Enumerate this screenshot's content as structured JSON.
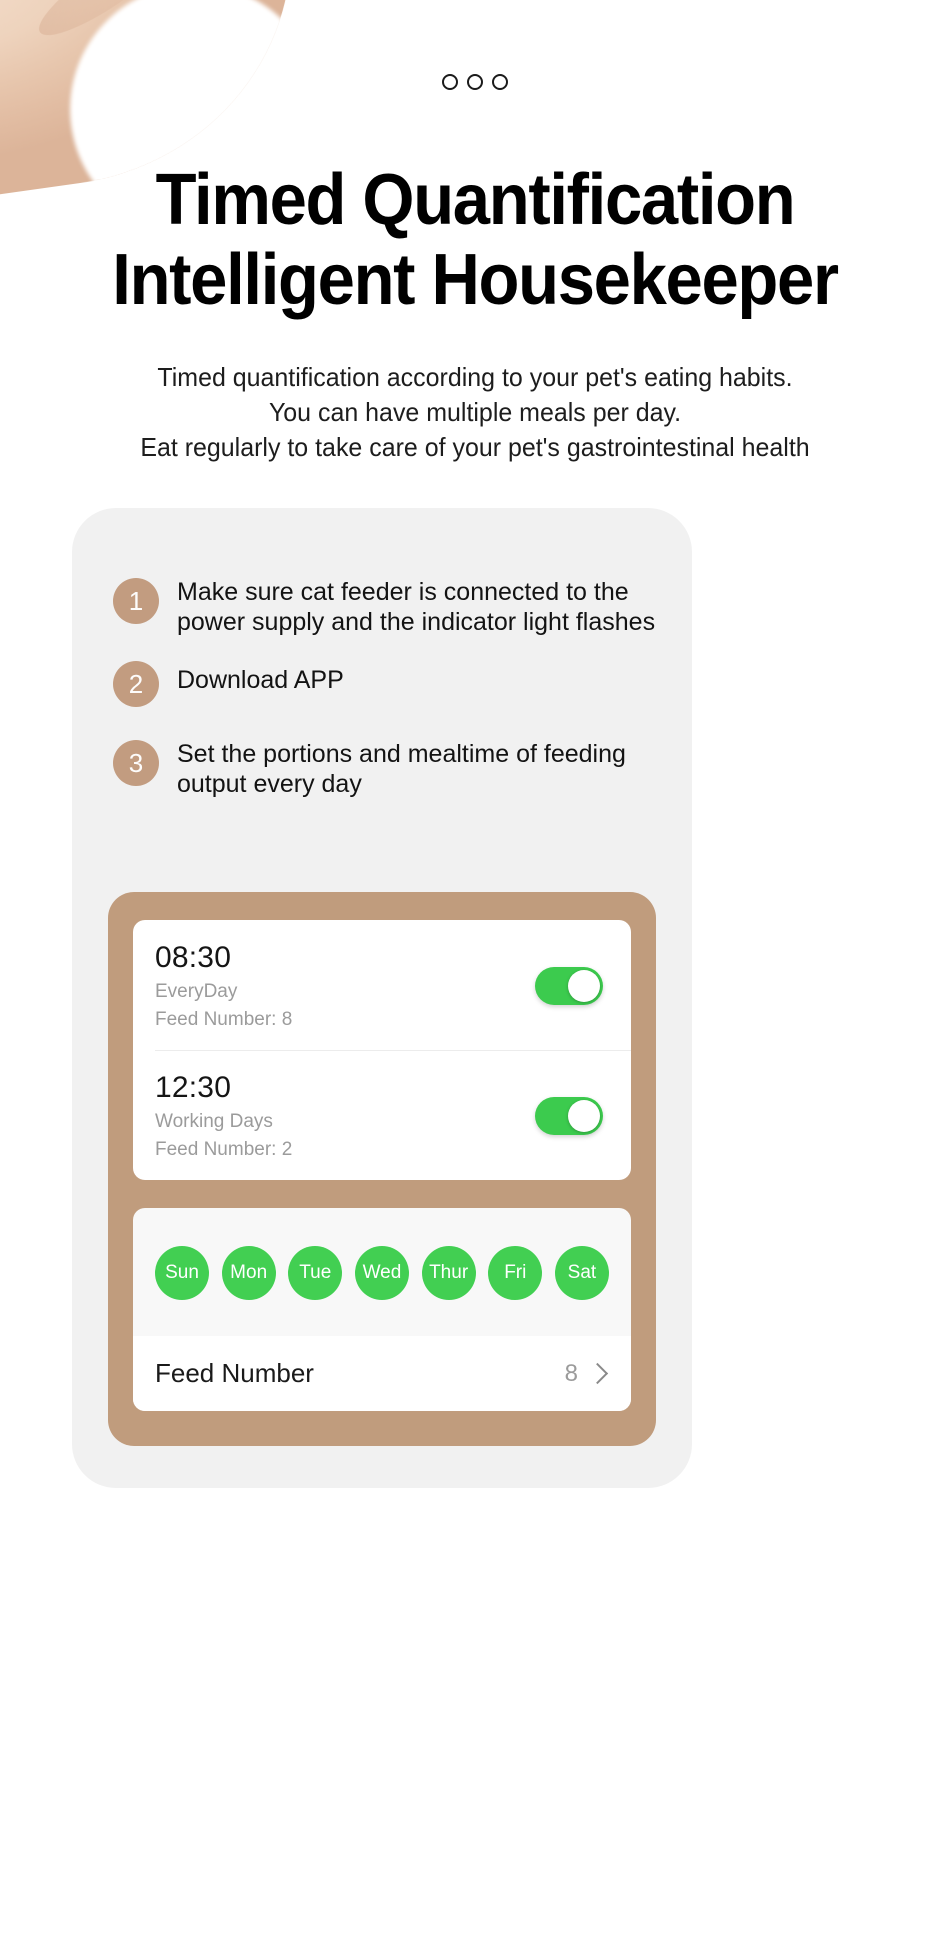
{
  "decor": {
    "hand_image": "hand-photo",
    "dots": [
      "dot-1",
      "dot-2",
      "dot-3"
    ]
  },
  "hero": {
    "title_line1": "Timed Quantification",
    "title_line2": "Intelligent Housekeeper",
    "subtitle_line1": "Timed quantification according to your pet's eating habits.",
    "subtitle_line2": "You can have multiple meals per day.",
    "subtitle_line3": "Eat regularly to take care of your pet's gastrointestinal health"
  },
  "steps": [
    {
      "number": "1",
      "text": "Make sure cat feeder is connected to the power supply and the indicator light flashes"
    },
    {
      "number": "2",
      "text": "Download APP"
    },
    {
      "number": "3",
      "text": "Set the portions and mealtime of feeding output every day"
    }
  ],
  "app": {
    "schedules": [
      {
        "time": "08:30",
        "repeat": "EveryDay",
        "feed": "Feed Number: 8",
        "toggle_on": true
      },
      {
        "time": "12:30",
        "repeat": "Working Days",
        "feed": "Feed Number: 2",
        "toggle_on": true
      }
    ],
    "days": [
      "Sun",
      "Mon",
      "Tue",
      "Wed",
      "Thur",
      "Fri",
      "Sat"
    ],
    "feed_number": {
      "label": "Feed Number",
      "value": "8"
    }
  },
  "colors": {
    "accent_brown": "#c09c7d",
    "step_badge": "#c29c80",
    "toggle_green": "#3ccb4e",
    "day_green": "#42cf52",
    "panel_grey": "#f1f1f1",
    "page_bg": "#ffffff"
  }
}
